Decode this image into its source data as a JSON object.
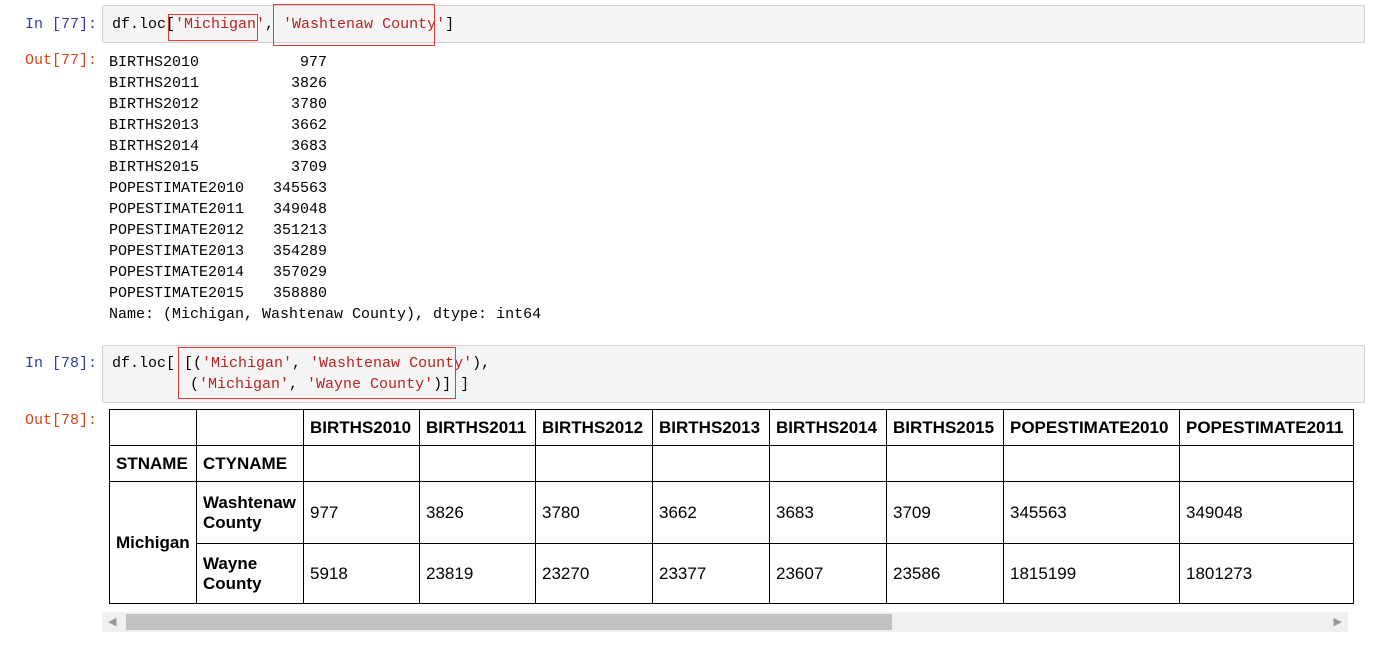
{
  "cell77": {
    "in_prompt": "In  [77]:",
    "code_prefix": "df.loc[",
    "str1": "'Michigan'",
    "sep": ", ",
    "str2": "'Washtenaw County'",
    "code_suffix": "]",
    "out_prompt": "Out[77]:",
    "series": [
      {
        "key": "BIRTHS2010",
        "value": "977"
      },
      {
        "key": "BIRTHS2011",
        "value": "3826"
      },
      {
        "key": "BIRTHS2012",
        "value": "3780"
      },
      {
        "key": "BIRTHS2013",
        "value": "3662"
      },
      {
        "key": "BIRTHS2014",
        "value": "3683"
      },
      {
        "key": "BIRTHS2015",
        "value": "3709"
      },
      {
        "key": "POPESTIMATE2010",
        "value": "345563"
      },
      {
        "key": "POPESTIMATE2011",
        "value": "349048"
      },
      {
        "key": "POPESTIMATE2012",
        "value": "351213"
      },
      {
        "key": "POPESTIMATE2013",
        "value": "354289"
      },
      {
        "key": "POPESTIMATE2014",
        "value": "357029"
      },
      {
        "key": "POPESTIMATE2015",
        "value": "358880"
      }
    ],
    "footer": "Name: (Michigan, Washtenaw County), dtype: int64"
  },
  "cell78": {
    "in_prompt": "In  [78]:",
    "l1_prefix": "df.loc[ [(",
    "l1_s1": "'Michigan'",
    "l1_sep": ", ",
    "l1_s2": "'Washtenaw County'",
    "l1_suffix": "),",
    "l2_prefix": "(",
    "l2_s1": "'Michigan'",
    "l2_sep": ", ",
    "l2_s2": "'Wayne County'",
    "l2_suffix": ")] ]",
    "out_prompt": "Out[78]:",
    "table": {
      "columns": [
        "BIRTHS2010",
        "BIRTHS2011",
        "BIRTHS2012",
        "BIRTHS2013",
        "BIRTHS2014",
        "BIRTHS2015",
        "POPESTIMATE2010",
        "POPESTIMATE2011"
      ],
      "index_names": [
        "STNAME",
        "CTYNAME"
      ],
      "state": "Michigan",
      "rows": [
        {
          "county": "Washtenaw County",
          "values": [
            "977",
            "3826",
            "3780",
            "3662",
            "3683",
            "3709",
            "345563",
            "349048"
          ]
        },
        {
          "county": "Wayne County",
          "values": [
            "5918",
            "23819",
            "23270",
            "23377",
            "23607",
            "23586",
            "1815199",
            "1801273"
          ]
        }
      ]
    }
  }
}
